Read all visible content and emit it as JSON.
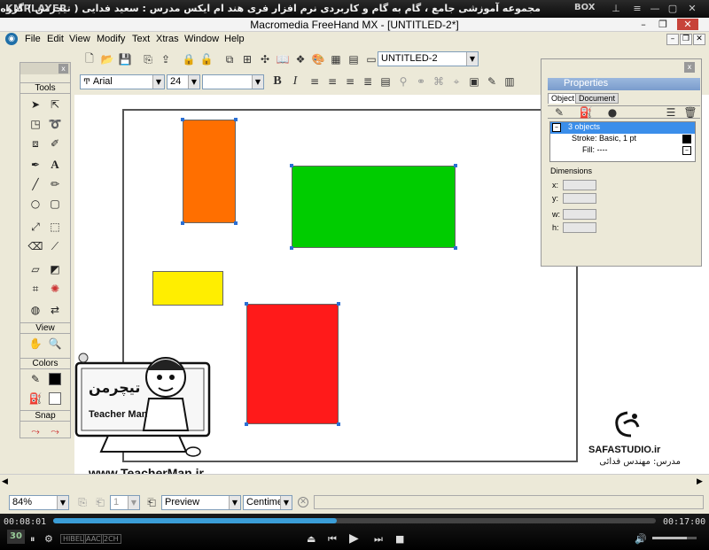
{
  "player": {
    "logo": "KMPLAYER",
    "title": "مجموعه آموزشی جامع ، گام به گام و کاربردی نرم افزار فری هند ام ایکس   مدرس : سعید فدایی ( تیچرمن ) گروه آموزشی پادشاه گرافیست ها",
    "box_label": "BOX",
    "time_current": "00:08:01",
    "time_total": "00:17:00",
    "progress": 0.47,
    "volume": 0.78,
    "badges": [
      "30",
      "HIBEL",
      "AAC",
      "2CH"
    ]
  },
  "app": {
    "title": "Macromedia FreeHand MX - [UNTITLED-2*]",
    "menus": [
      "File",
      "Edit",
      "View",
      "Modify",
      "Text",
      "Xtras",
      "Window",
      "Help"
    ],
    "document_select": "UNTITLED-2",
    "font_family": "Arial",
    "font_size": "24",
    "font_style": "",
    "bold_glyph": "B",
    "italic_glyph": "I"
  },
  "tools": {
    "title": "Tools",
    "view_title": "View",
    "colors_title": "Colors",
    "snap_title": "Snap"
  },
  "properties": {
    "title": "Properties",
    "tabs": [
      "Object",
      "Document"
    ],
    "selection": "3 objects",
    "stroke": "Stroke: Basic, 1 pt",
    "fill": "Fill: ----",
    "dimensions_title": "Dimensions",
    "dim_labels": [
      "x:",
      "y:",
      "w:",
      "h:"
    ]
  },
  "status": {
    "zoom": "84%",
    "page": "1",
    "preview": "Preview",
    "units": "Centimeters"
  },
  "watermark": {
    "url": "www.TeacherMan.ir",
    "brand_fa": "تیچرمن",
    "brand_en": "Teacher Man",
    "studio": "SAFASTUDIO.ir",
    "teacher": "مدرس: مهندس فدائی"
  },
  "colors": {
    "orange": "#ff6f00",
    "green": "#00cc00",
    "yellow": "#ffee00",
    "red": "#ff1a1a",
    "selection": "#2a6fd4"
  }
}
